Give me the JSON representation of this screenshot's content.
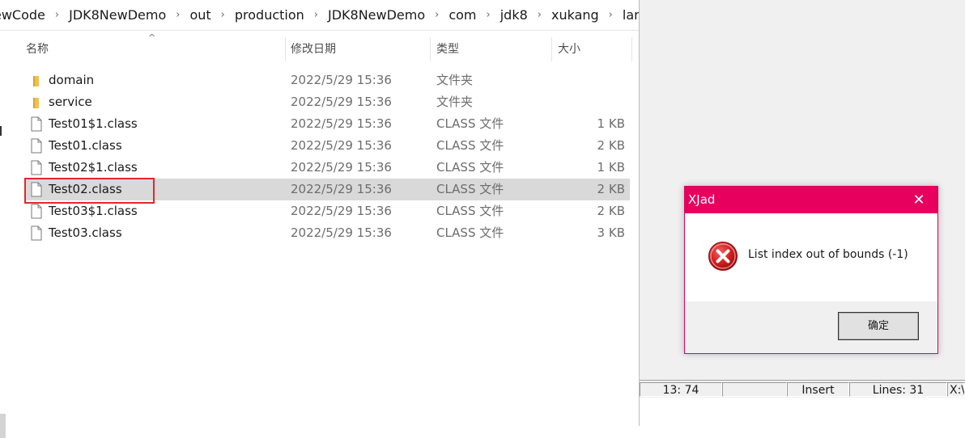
{
  "breadcrumb": [
    "ewCode",
    "JDK8NewDemo",
    "out",
    "production",
    "JDK8NewDemo",
    "com",
    "jdk8",
    "xukang",
    "lambda"
  ],
  "columns": {
    "name": "名称",
    "date": "修改日期",
    "type": "类型",
    "size": "大小"
  },
  "files": [
    {
      "name": "domain",
      "date": "2022/5/29 15:36",
      "type": "文件夹",
      "size": "",
      "kind": "folder"
    },
    {
      "name": "service",
      "date": "2022/5/29 15:36",
      "type": "文件夹",
      "size": "",
      "kind": "folder"
    },
    {
      "name": "Test01$1.class",
      "date": "2022/5/29 15:36",
      "type": "CLASS 文件",
      "size": "1 KB",
      "kind": "file"
    },
    {
      "name": "Test01.class",
      "date": "2022/5/29 15:36",
      "type": "CLASS 文件",
      "size": "2 KB",
      "kind": "file"
    },
    {
      "name": "Test02$1.class",
      "date": "2022/5/29 15:36",
      "type": "CLASS 文件",
      "size": "1 KB",
      "kind": "file"
    },
    {
      "name": "Test02.class",
      "date": "2022/5/29 15:36",
      "type": "CLASS 文件",
      "size": "2 KB",
      "kind": "file",
      "selected": true
    },
    {
      "name": "Test03$1.class",
      "date": "2022/5/29 15:36",
      "type": "CLASS 文件",
      "size": "2 KB",
      "kind": "file"
    },
    {
      "name": "Test03.class",
      "date": "2022/5/29 15:36",
      "type": "CLASS 文件",
      "size": "3 KB",
      "kind": "file"
    }
  ],
  "statusbar": {
    "position": "13: 74",
    "mode": "Insert",
    "lines": "Lines: 31",
    "extra": "X:\\"
  },
  "dialog": {
    "title": "XJad",
    "close_glyph": "✕",
    "message": "List index out of bounds (-1)",
    "ok_label": "确定",
    "icon": "error-icon"
  },
  "colors": {
    "dialog_accent": "#e8005e",
    "highlight": "#e0282e",
    "folder": "#f0c24b",
    "selection": "#d9d9d9"
  }
}
